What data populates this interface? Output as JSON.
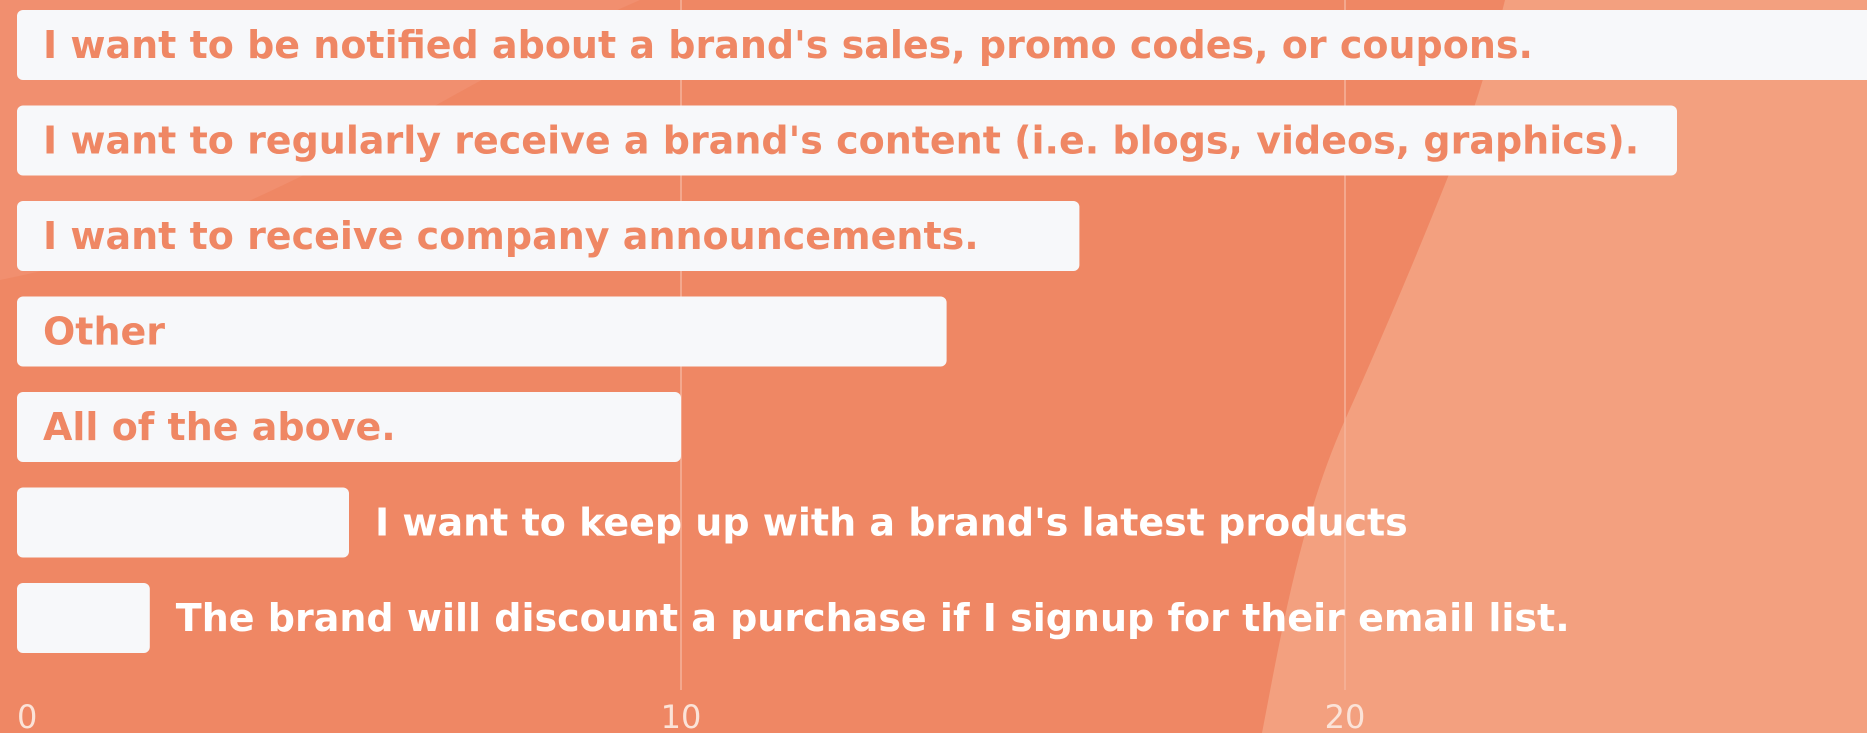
{
  "chart_data": {
    "type": "bar",
    "orientation": "horizontal",
    "categories": [
      "I want to be notified about a brand's sales, promo codes, or coupons.",
      "I want to regularly receive a brand's content (i.e. blogs, videos, graphics).",
      "I want to receive company announcements.",
      "Other",
      "All of the above.",
      "I want to keep up with a brand's latest products",
      "The brand will discount a purchase if I signup for their email list."
    ],
    "values": [
      28.5,
      25,
      16,
      14,
      10,
      5,
      2
    ],
    "xlim": [
      0,
      28
    ],
    "xticks": [
      0,
      10,
      20
    ],
    "xtick_labels": [
      "0",
      "10",
      "20"
    ],
    "grid": true,
    "title": "",
    "xlabel": "",
    "ylabel": ""
  },
  "colors": {
    "background": "#ef8764",
    "background_light": "#f3a07f",
    "bar_fill": "#f7f8fa",
    "label_on_bar": "#ef8764",
    "label_outside": "#ffffff",
    "tick_text": "#fbe3d8",
    "grid": "#f6b49b"
  }
}
